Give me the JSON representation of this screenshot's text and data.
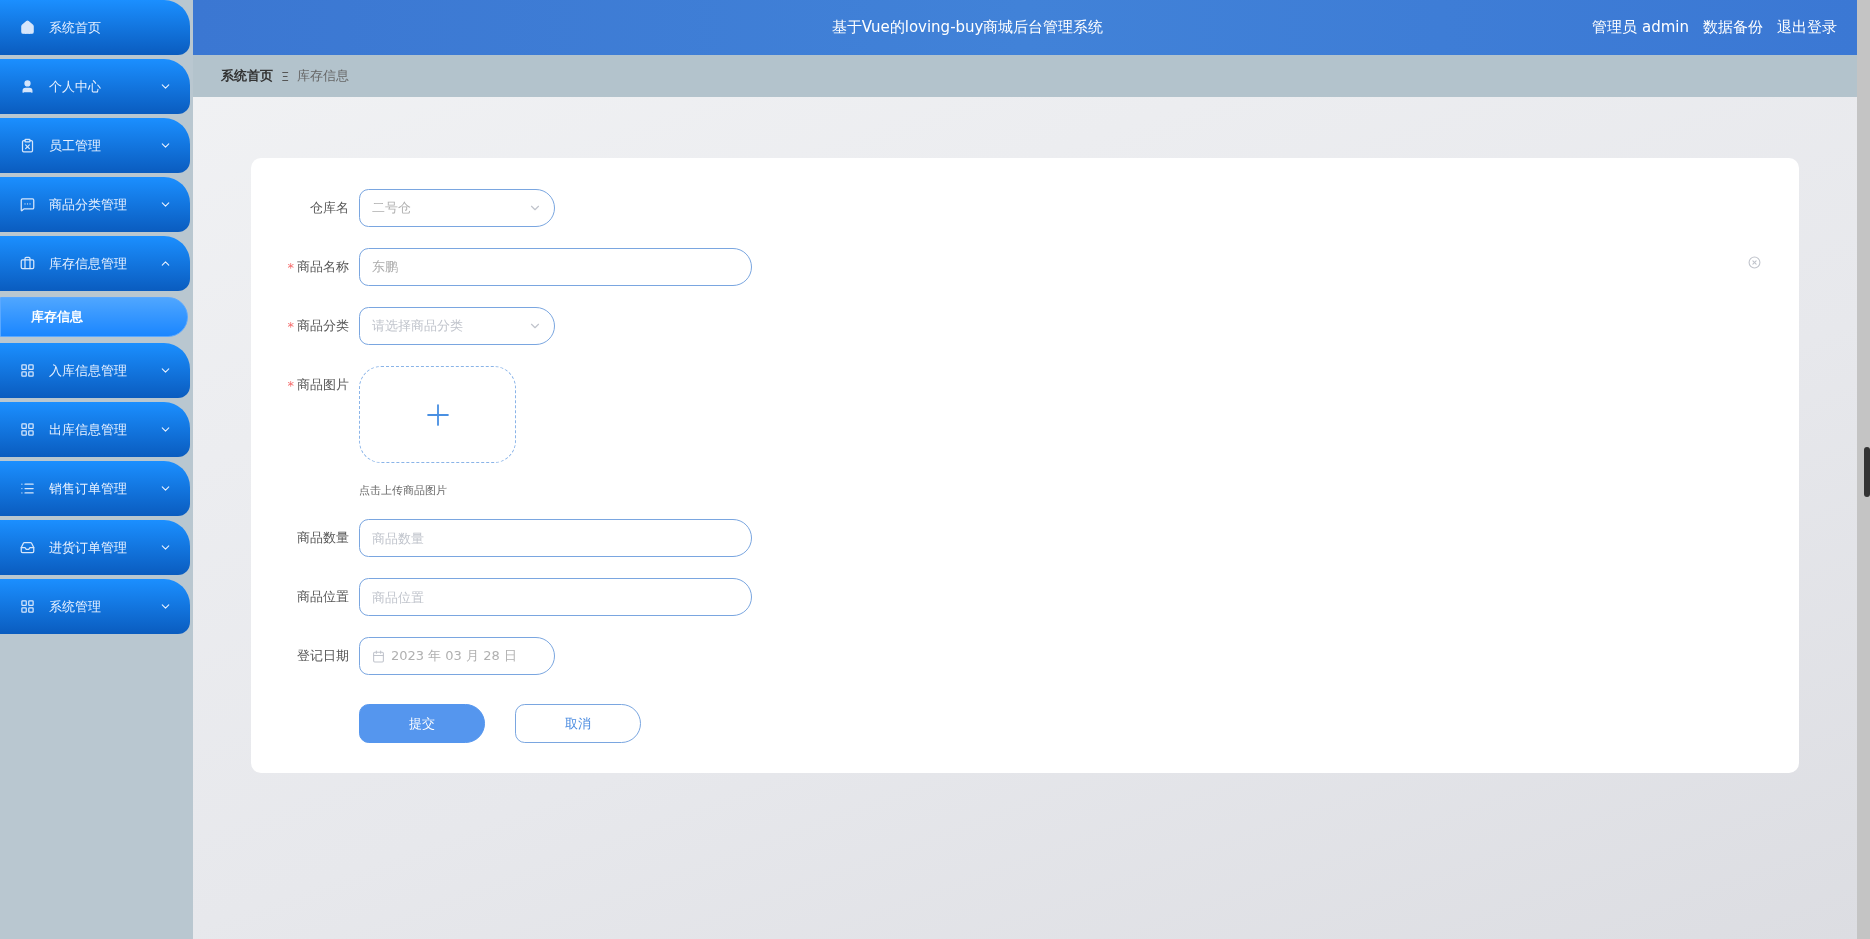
{
  "sidebar": {
    "items": [
      {
        "label": "系统首页"
      },
      {
        "label": "个人中心",
        "expanded": false
      },
      {
        "label": "员工管理",
        "expanded": false
      },
      {
        "label": "商品分类管理",
        "expanded": false
      },
      {
        "label": "库存信息管理",
        "expanded": true,
        "children": [
          {
            "label": "库存信息",
            "selected": true
          }
        ]
      },
      {
        "label": "入库信息管理",
        "expanded": false
      },
      {
        "label": "出库信息管理",
        "expanded": false
      },
      {
        "label": "销售订单管理",
        "expanded": false
      },
      {
        "label": "进货订单管理",
        "expanded": false
      },
      {
        "label": "系统管理",
        "expanded": false
      }
    ]
  },
  "header": {
    "title": "基于Vue的loving-buy商城后台管理系统",
    "links": [
      "管理员 admin",
      "数据备份",
      "退出登录"
    ]
  },
  "breadcrumb": [
    "系统首页",
    "库存信息"
  ],
  "breadcrumb_separator": "Ξ",
  "form": {
    "required_mark": "*",
    "fields": [
      {
        "kind": "select",
        "label": "仓库名",
        "required": false,
        "value": "二号仓"
      },
      {
        "kind": "input",
        "label": "商品名称",
        "required": true,
        "value": "东鹏"
      },
      {
        "kind": "select",
        "label": "商品分类",
        "required": true,
        "placeholder": "请选择商品分类"
      },
      {
        "kind": "upload",
        "label": "商品图片",
        "required": true,
        "hint": "点击上传商品图片"
      },
      {
        "kind": "input",
        "label": "商品数量",
        "required": false,
        "placeholder": "商品数量"
      },
      {
        "kind": "input",
        "label": "商品位置",
        "required": false,
        "placeholder": "商品位置"
      },
      {
        "kind": "date",
        "label": "登记日期",
        "required": false,
        "value": "2023 年 03 月 28 日"
      }
    ],
    "buttons": [
      {
        "label": "提交",
        "kind": "primary"
      },
      {
        "label": "取消",
        "kind": "plain"
      }
    ]
  }
}
